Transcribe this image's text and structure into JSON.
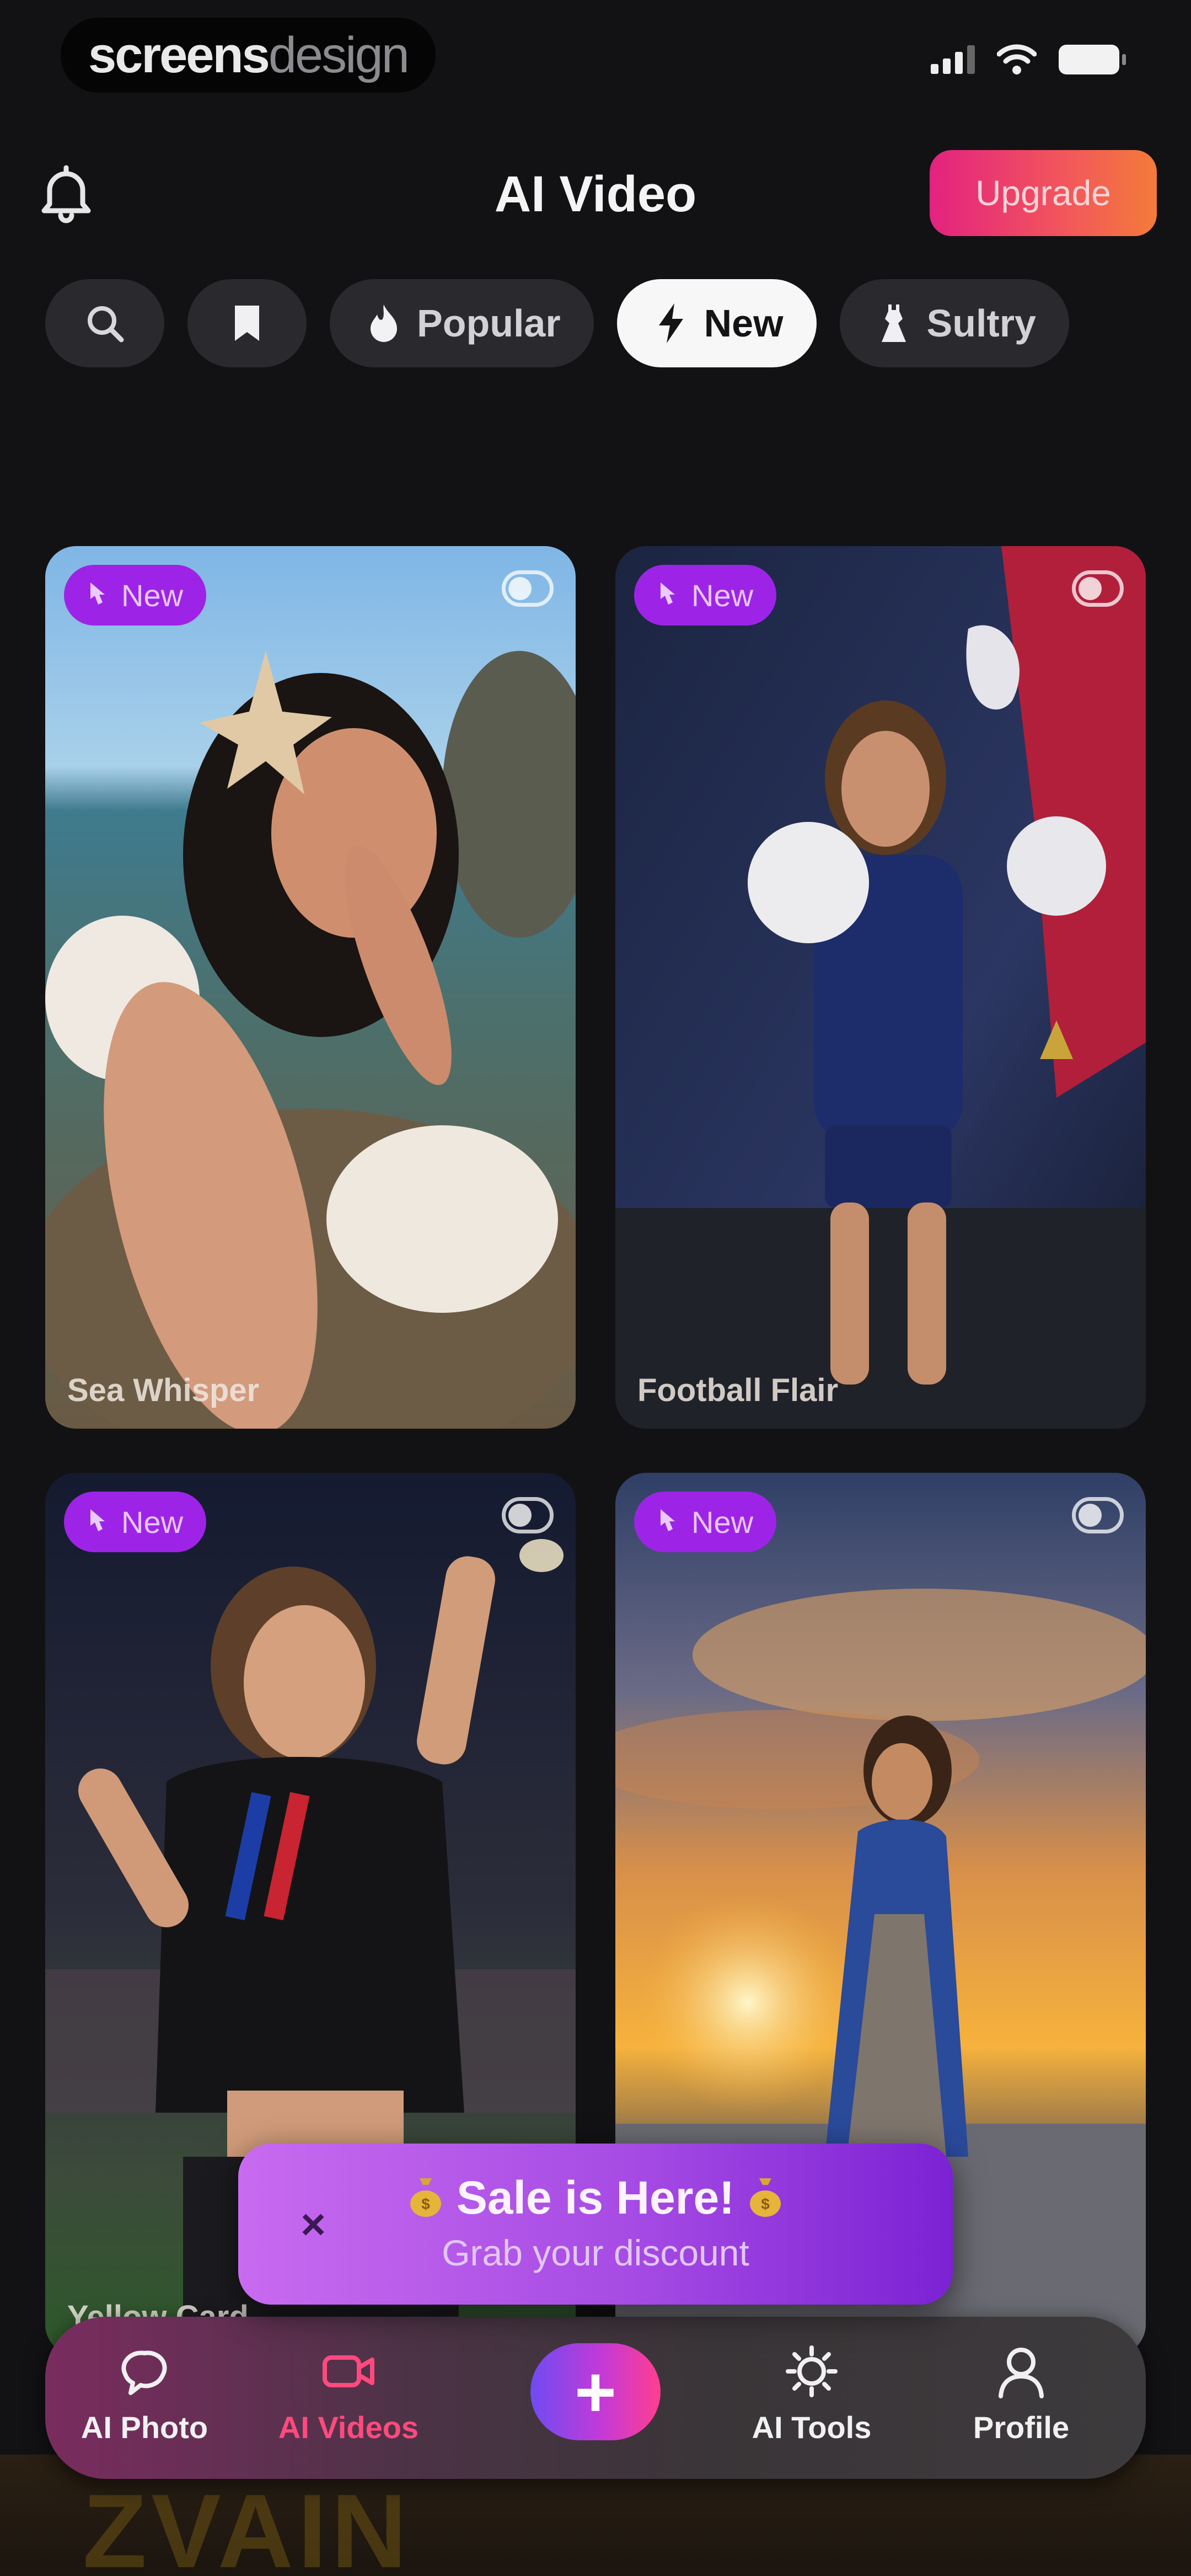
{
  "status_bar": {
    "watermark_part1": "screens",
    "watermark_part2": "design"
  },
  "header": {
    "title": "AI Video",
    "upgrade_label": "Upgrade"
  },
  "filters": {
    "search_icon": "search-icon",
    "bookmark_icon": "bookmark-icon",
    "chips": [
      {
        "label": "Popular",
        "icon": "fire-icon",
        "active": false
      },
      {
        "label": "New",
        "icon": "bolt-icon",
        "active": true
      },
      {
        "label": "Sultry",
        "icon": "dress-icon",
        "active": false
      }
    ]
  },
  "cards": [
    {
      "badge": "New",
      "title": "Sea Whisper"
    },
    {
      "badge": "New",
      "title": "Football Flair"
    },
    {
      "badge": "New",
      "title": "Yellow Card"
    },
    {
      "badge": "New",
      "title": ""
    }
  ],
  "sale": {
    "title": "Sale is Here!",
    "subtitle": "Grab your discount",
    "close_label": "×"
  },
  "bottom_nav": {
    "items": [
      {
        "label": "AI Photo",
        "icon": "photo-icon",
        "active": false
      },
      {
        "label": "AI Videos",
        "icon": "video-icon",
        "active": true
      },
      {
        "label": "AI Tools",
        "icon": "tools-icon",
        "active": false
      },
      {
        "label": "Profile",
        "icon": "profile-icon",
        "active": false
      }
    ],
    "plus_label": "+"
  },
  "bottom_text": "ZVAIN",
  "colors": {
    "background": "#121214",
    "accent_pink": "#ff4a7d",
    "badge_purple": "#9d24e6",
    "upgrade_gradient_start": "#e3227f",
    "upgrade_gradient_end": "#f47b3a"
  }
}
